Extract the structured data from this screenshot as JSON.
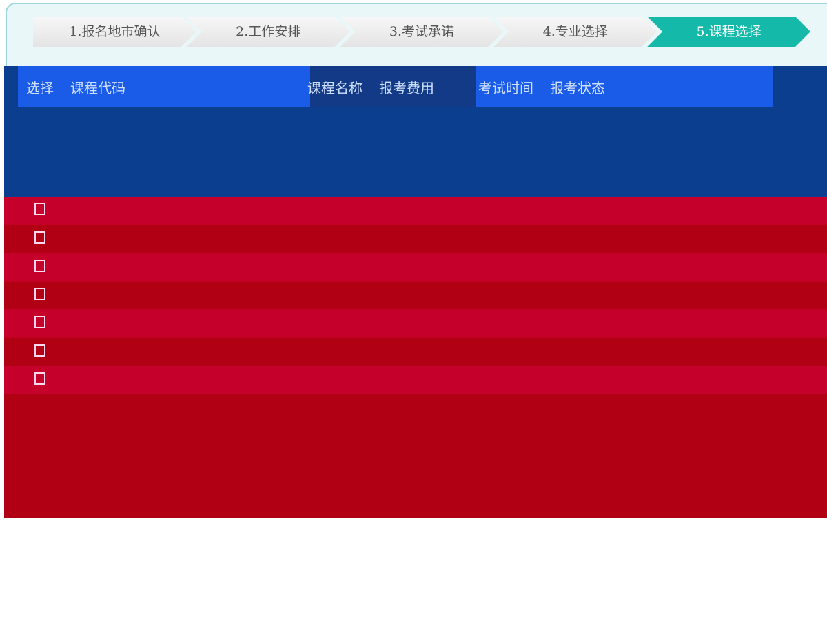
{
  "steps": [
    {
      "label": "1.报名地市确认"
    },
    {
      "label": "2.工作安排"
    },
    {
      "label": "3.考试承诺"
    },
    {
      "label": "4.专业选择"
    },
    {
      "label": "5.课程选择"
    }
  ],
  "table": {
    "headers": [
      "选择",
      "课程代码",
      "课程名称",
      "报考费用",
      "考试时间",
      "报考状态"
    ]
  },
  "colors": {
    "active_step": "#14b9a9",
    "header_band": "#0b3e8e",
    "body_panel": "#b10014"
  }
}
